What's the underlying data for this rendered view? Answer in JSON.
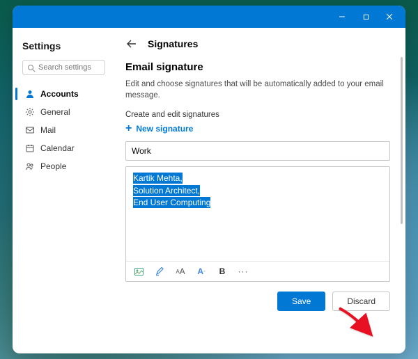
{
  "window_controls": {
    "minimize": "minimize",
    "maximize": "maximize",
    "close": "close"
  },
  "sidebar": {
    "title": "Settings",
    "search_placeholder": "Search settings",
    "items": [
      {
        "label": "Accounts",
        "icon": "person-icon",
        "active": true
      },
      {
        "label": "General",
        "icon": "gear-icon"
      },
      {
        "label": "Mail",
        "icon": "mail-icon"
      },
      {
        "label": "Calendar",
        "icon": "calendar-icon"
      },
      {
        "label": "People",
        "icon": "people-icon"
      }
    ]
  },
  "main": {
    "breadcrumb": "Signatures",
    "section_title": "Email signature",
    "description": "Edit and choose signatures that will be automatically added to your email message.",
    "subhead": "Create and edit signatures",
    "new_signature_label": "New signature",
    "signature_name_value": "Work",
    "signature_body_lines": [
      "Kartik Mehta,",
      "Solution Architect,",
      "End User Computing"
    ],
    "toolbar": {
      "image": "image-icon",
      "highlight": "highlight-icon",
      "font_size": "font-size-icon",
      "font_color": "font-color-icon",
      "bold": "B",
      "more": "more-icon"
    },
    "buttons": {
      "save": "Save",
      "discard": "Discard"
    }
  },
  "colors": {
    "accent": "#0078d4"
  }
}
